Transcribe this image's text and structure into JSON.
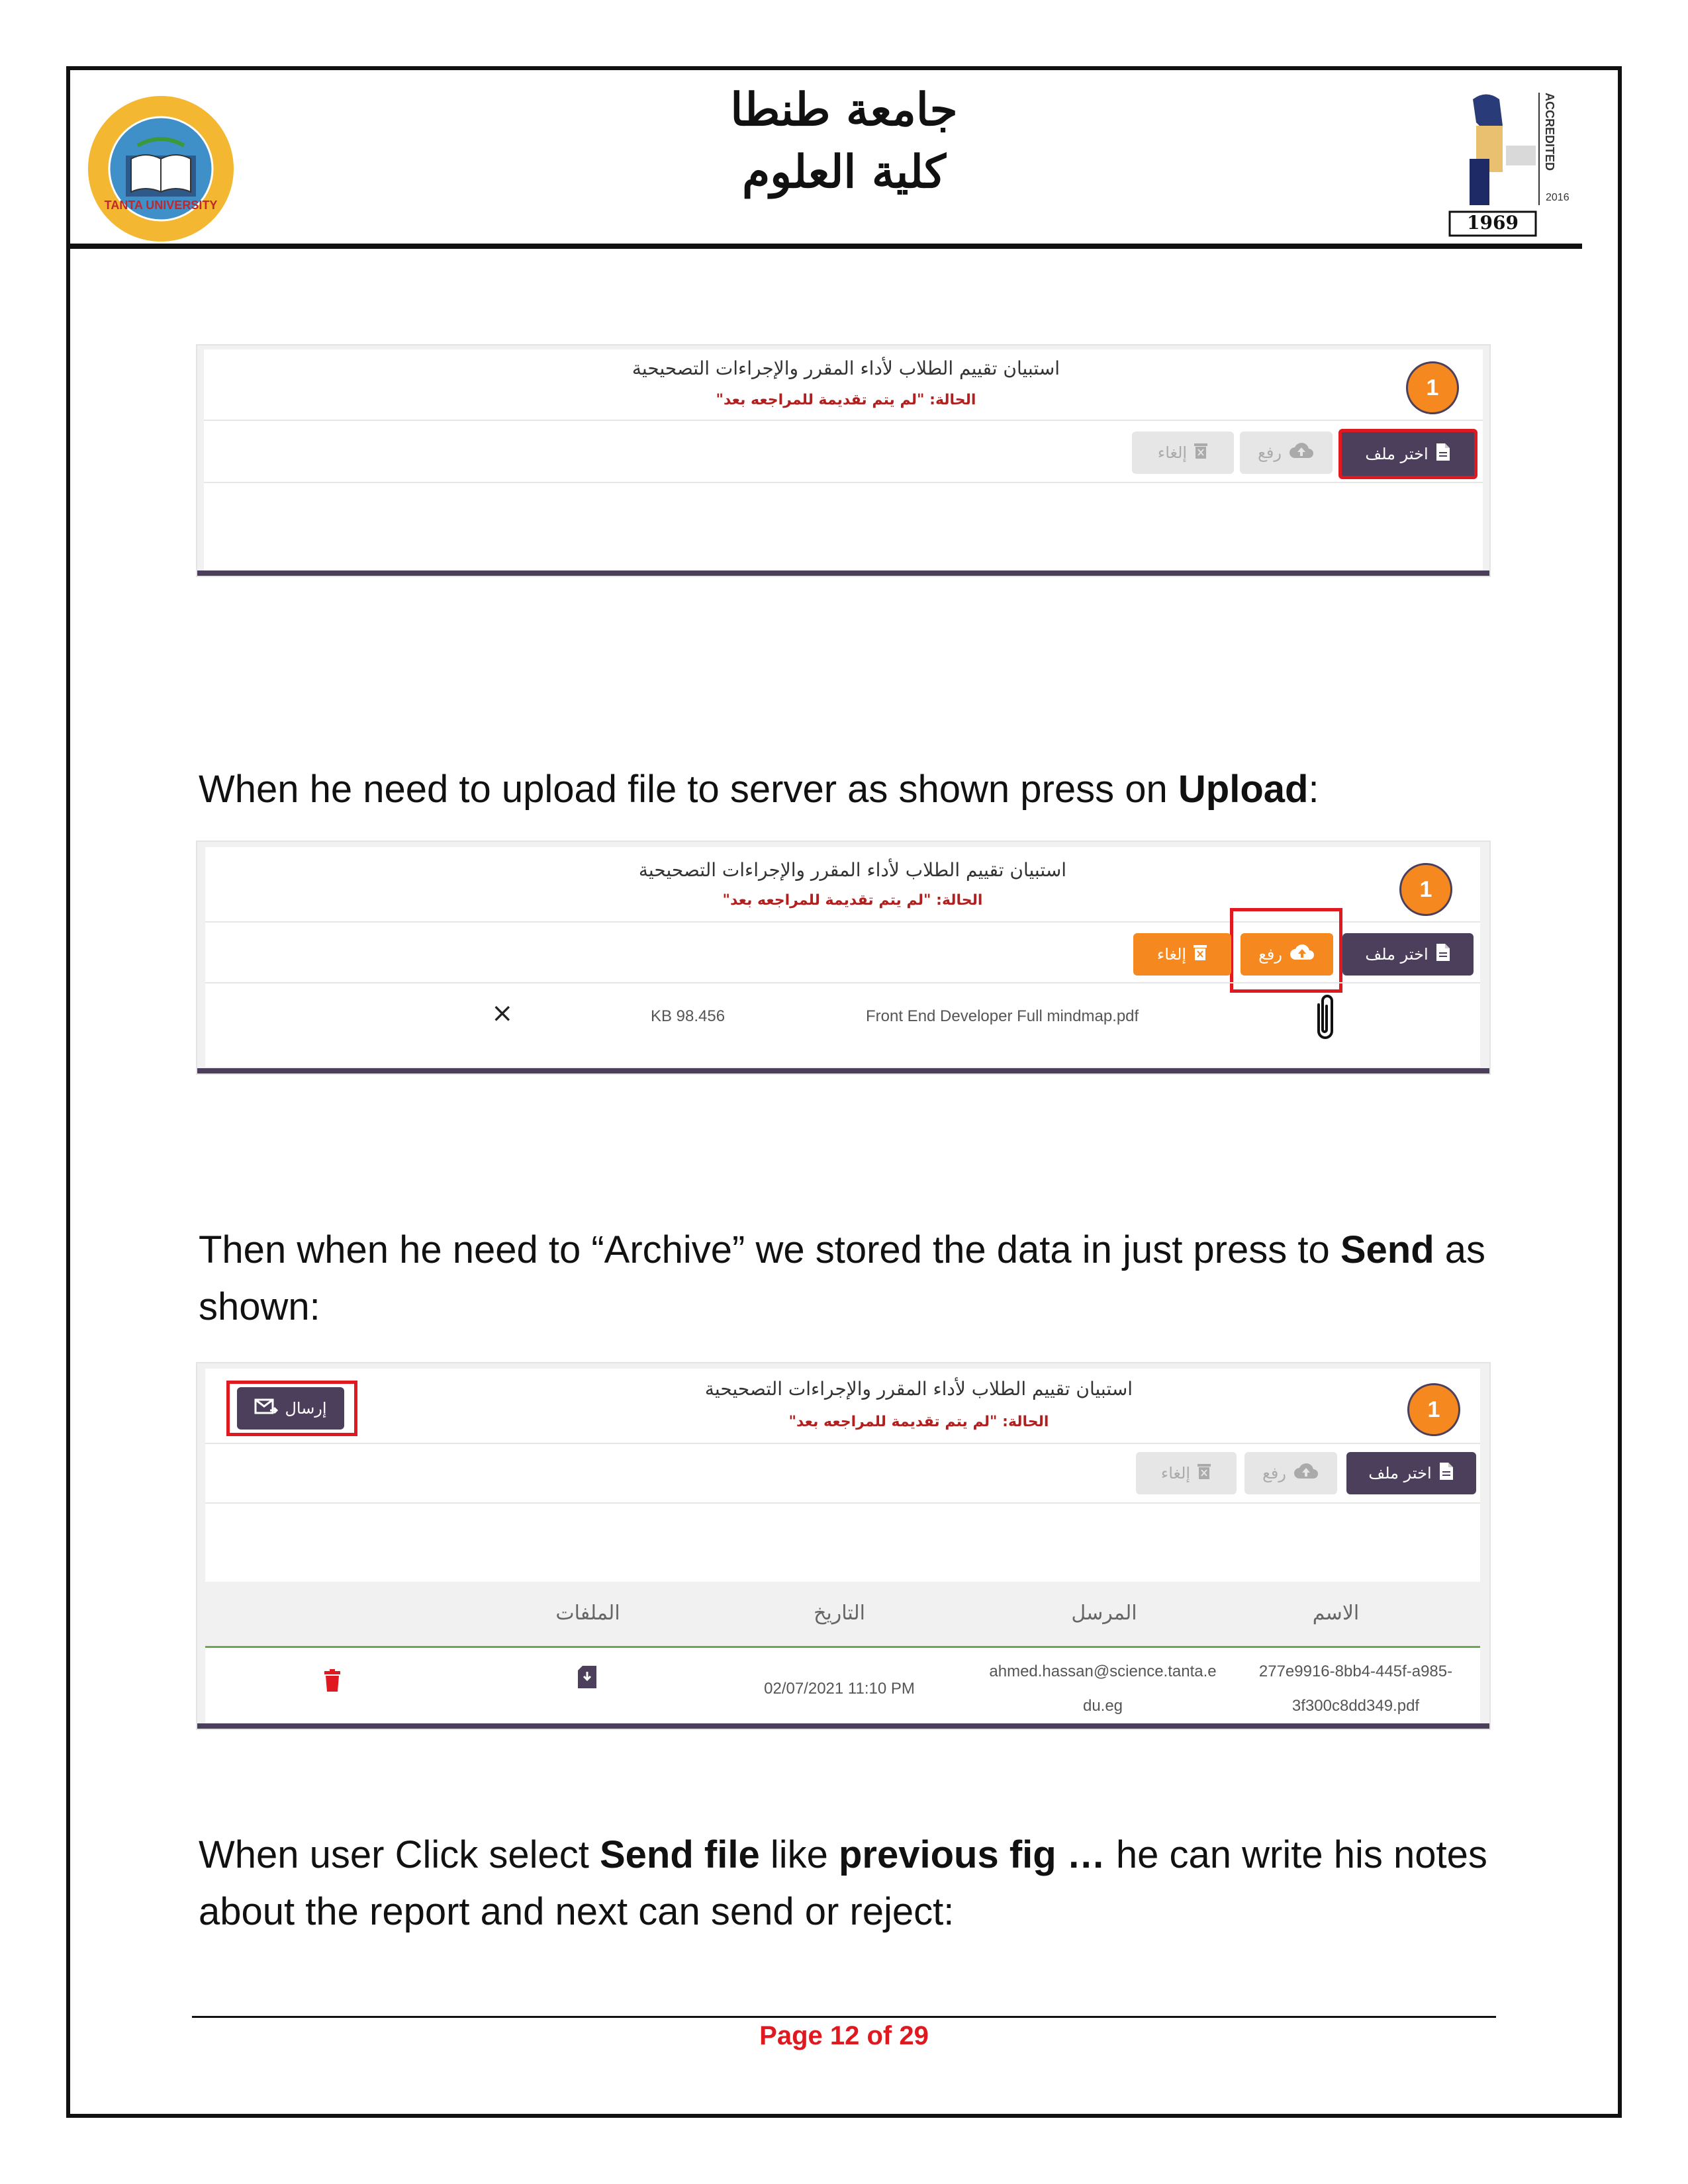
{
  "header": {
    "university": "جامعة طنطا",
    "faculty": "كلية العلوم",
    "left_logo_text": "TANTA UNIVERSITY",
    "right_logo_text": "ACCREDITED",
    "right_logo_year": "1969",
    "right_logo_year_small": "2016"
  },
  "form": {
    "badge": "1",
    "title": "استبيان تقييم الطلاب لأداء المقرر والإجراءات التصحيحية",
    "status_label": "الحالة:",
    "status_value": "\"لم يتم تقديمة للمراجعه بعد\"",
    "choose_file": "اختر ملف",
    "upload": "رفع",
    "cancel": "إلغاء",
    "send": "إرسال"
  },
  "screenshot2": {
    "file_name": "Front End Developer Full mindmap.pdf",
    "file_size": "KB 98.456",
    "remove": "×"
  },
  "screenshot3": {
    "table_headers": [
      "الاسم",
      "المرسل",
      "التاريخ",
      "الملفات"
    ],
    "row": {
      "name_line1": "277e9916-8bb4-445f-a985-",
      "name_line2": "3f300c8dd349.pdf",
      "sender_line1": "ahmed.hassan@science.tanta.e",
      "sender_line2": "du.eg",
      "date": "02/07/2021 11:10 PM"
    }
  },
  "text": {
    "p1_pre": "When he need to upload file to server as shown press on ",
    "p1_bold": "Upload",
    "p1_post": ":",
    "p2_pre": "Then when he need to “Archive” we stored the data in just press to ",
    "p2_bold": "Send",
    "p2_post": " as shown:",
    "p3_a": "When user Click select ",
    "p3_b": "Send file",
    "p3_c": " like ",
    "p3_d": "previous fig …",
    "p3_e": " he can write his notes about the report and next can send or reject:"
  },
  "footer": {
    "page": "Page 12 of 29"
  },
  "colors": {
    "accent_purple": "#4b3f5c",
    "accent_orange": "#f5891f",
    "highlight_red": "#e0181f",
    "status_red": "#b21f1f"
  }
}
